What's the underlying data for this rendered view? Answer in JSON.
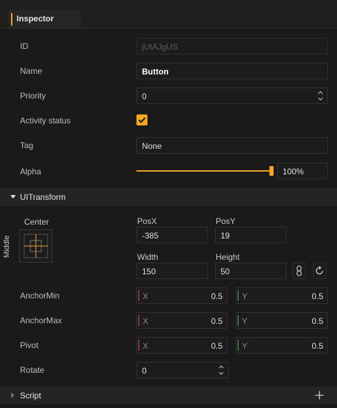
{
  "tab": {
    "title": "Inspector"
  },
  "fields": {
    "id_label": "ID",
    "id_value": "jUtAJgUS",
    "name_label": "Name",
    "name_value": "Button",
    "priority_label": "Priority",
    "priority_value": "0",
    "activity_label": "Activity status",
    "activity_checked": true,
    "tag_label": "Tag",
    "tag_value": "None",
    "alpha_label": "Alpha",
    "alpha_value": "100%",
    "alpha_level": 1.0
  },
  "uitransform": {
    "title": "UITransform",
    "anchor_preset_h": "Center",
    "anchor_preset_v": "Middle",
    "posx_label": "PosX",
    "posx_value": "-385",
    "posy_label": "PosY",
    "posy_value": "19",
    "width_label": "Width",
    "width_value": "150",
    "height_label": "Height",
    "height_value": "50",
    "anchormin_label": "AnchorMin",
    "anchormax_label": "AnchorMax",
    "pivot_label": "Pivot",
    "rotate_label": "Rotate",
    "rotate_value": "0",
    "x_letter": "X",
    "y_letter": "Y",
    "anchormin_x": "0.5",
    "anchormin_y": "0.5",
    "anchormax_x": "0.5",
    "anchormax_y": "0.5",
    "pivot_x": "0.5",
    "pivot_y": "0.5"
  },
  "script_section": {
    "title": "Script"
  },
  "colors": {
    "accent": "#f5a623",
    "x_axis": "#d9534f",
    "y_axis": "#5cb85c"
  }
}
